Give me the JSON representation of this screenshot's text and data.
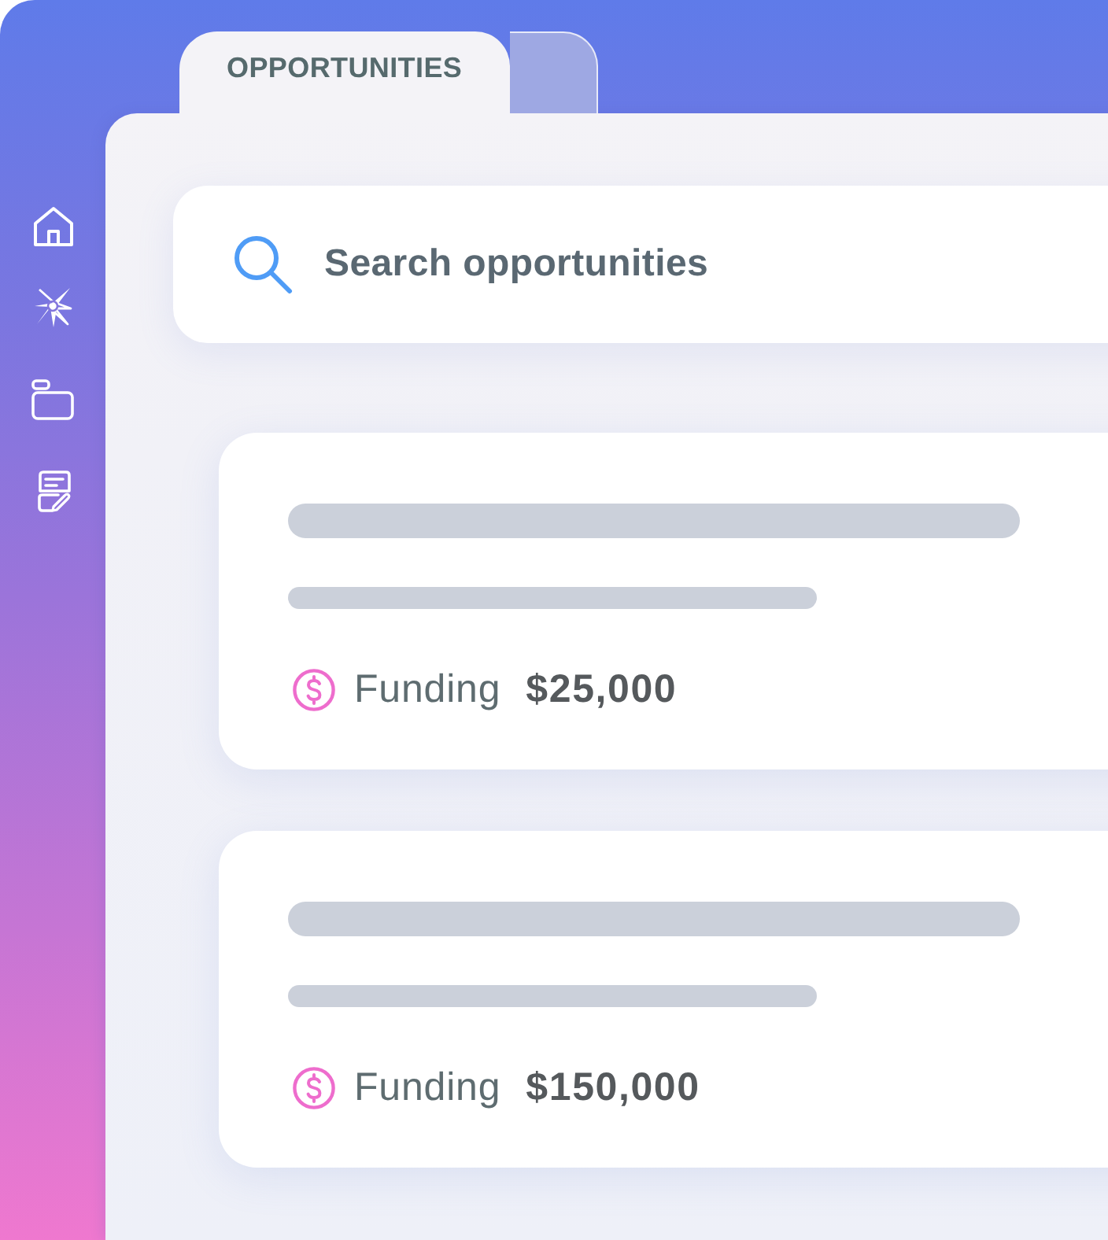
{
  "tabs": [
    {
      "label": "OPPORTUNITIES",
      "selected": true
    },
    {
      "selected": false
    }
  ],
  "search": {
    "placeholder": "Search opportunities"
  },
  "opportunities": [
    {
      "funding_label": "Funding",
      "amount": "$25,000"
    },
    {
      "funding_label": "Funding",
      "amount": "$150,000"
    }
  ]
}
